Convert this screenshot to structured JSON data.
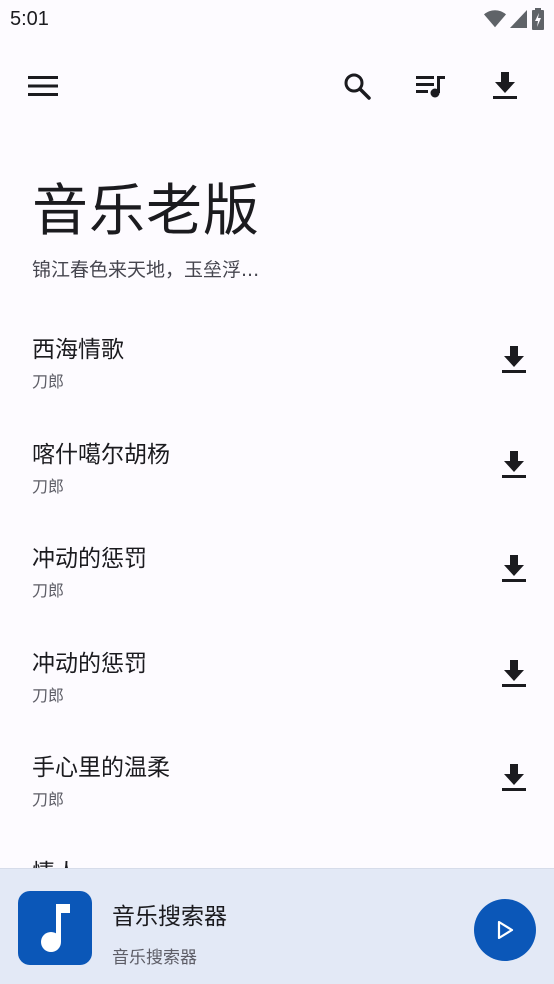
{
  "status": {
    "time": "5:01"
  },
  "toolbar": {
    "menu_icon": "menu-icon",
    "search_icon": "search-icon",
    "queue_icon": "queue-music-icon",
    "download_icon": "download-icon"
  },
  "header": {
    "title": "音乐老版",
    "subtitle": "锦江春色来天地，玉垒浮..."
  },
  "songs": [
    {
      "title": "西海情歌",
      "artist": "刀郎"
    },
    {
      "title": "喀什噶尔胡杨",
      "artist": "刀郎"
    },
    {
      "title": "冲动的惩罚",
      "artist": "刀郎"
    },
    {
      "title": "冲动的惩罚",
      "artist": "刀郎"
    },
    {
      "title": "手心里的温柔",
      "artist": "刀郎"
    },
    {
      "title": "情人",
      "artist": ""
    }
  ],
  "player": {
    "title": "音乐搜索器",
    "subtitle": "音乐搜索器"
  },
  "colors": {
    "accent": "#0b57b8",
    "background": "#fdfbff",
    "player_bg": "#e3e9f6"
  }
}
